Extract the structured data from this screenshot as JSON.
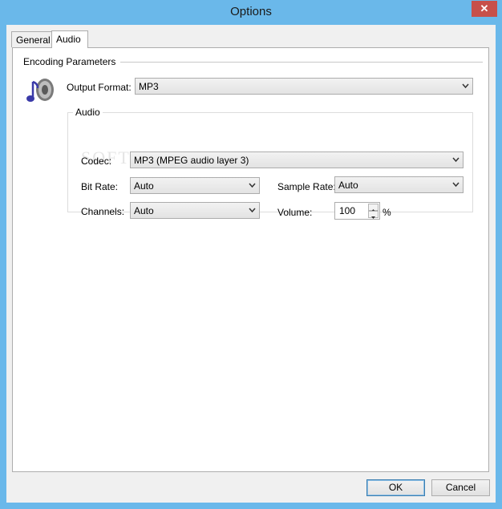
{
  "window": {
    "title": "Options",
    "close_glyph": "✕"
  },
  "tabs": [
    {
      "label": "General",
      "active": false
    },
    {
      "label": "Audio",
      "active": true
    }
  ],
  "encoding": {
    "section_title": "Encoding Parameters",
    "output_format_label": "Output Format:",
    "output_format_value": "MP3",
    "icon": "music-speaker-icon"
  },
  "audio_group": {
    "title": "Audio",
    "codec_label": "Codec:",
    "codec_value": "MP3 (MPEG audio layer 3)",
    "bitrate_label": "Bit Rate:",
    "bitrate_value": "Auto",
    "samplerate_label": "Sample Rate:",
    "samplerate_value": "Auto",
    "channels_label": "Channels:",
    "channels_value": "Auto",
    "volume_label": "Volume:",
    "volume_value": "100",
    "volume_unit": "%"
  },
  "watermark": "SOFTPEDIA",
  "buttons": {
    "ok": "OK",
    "cancel": "Cancel"
  },
  "colors": {
    "frame": "#6ab8ea",
    "close": "#c7504a",
    "default_button_border": "#3c7fb1"
  }
}
